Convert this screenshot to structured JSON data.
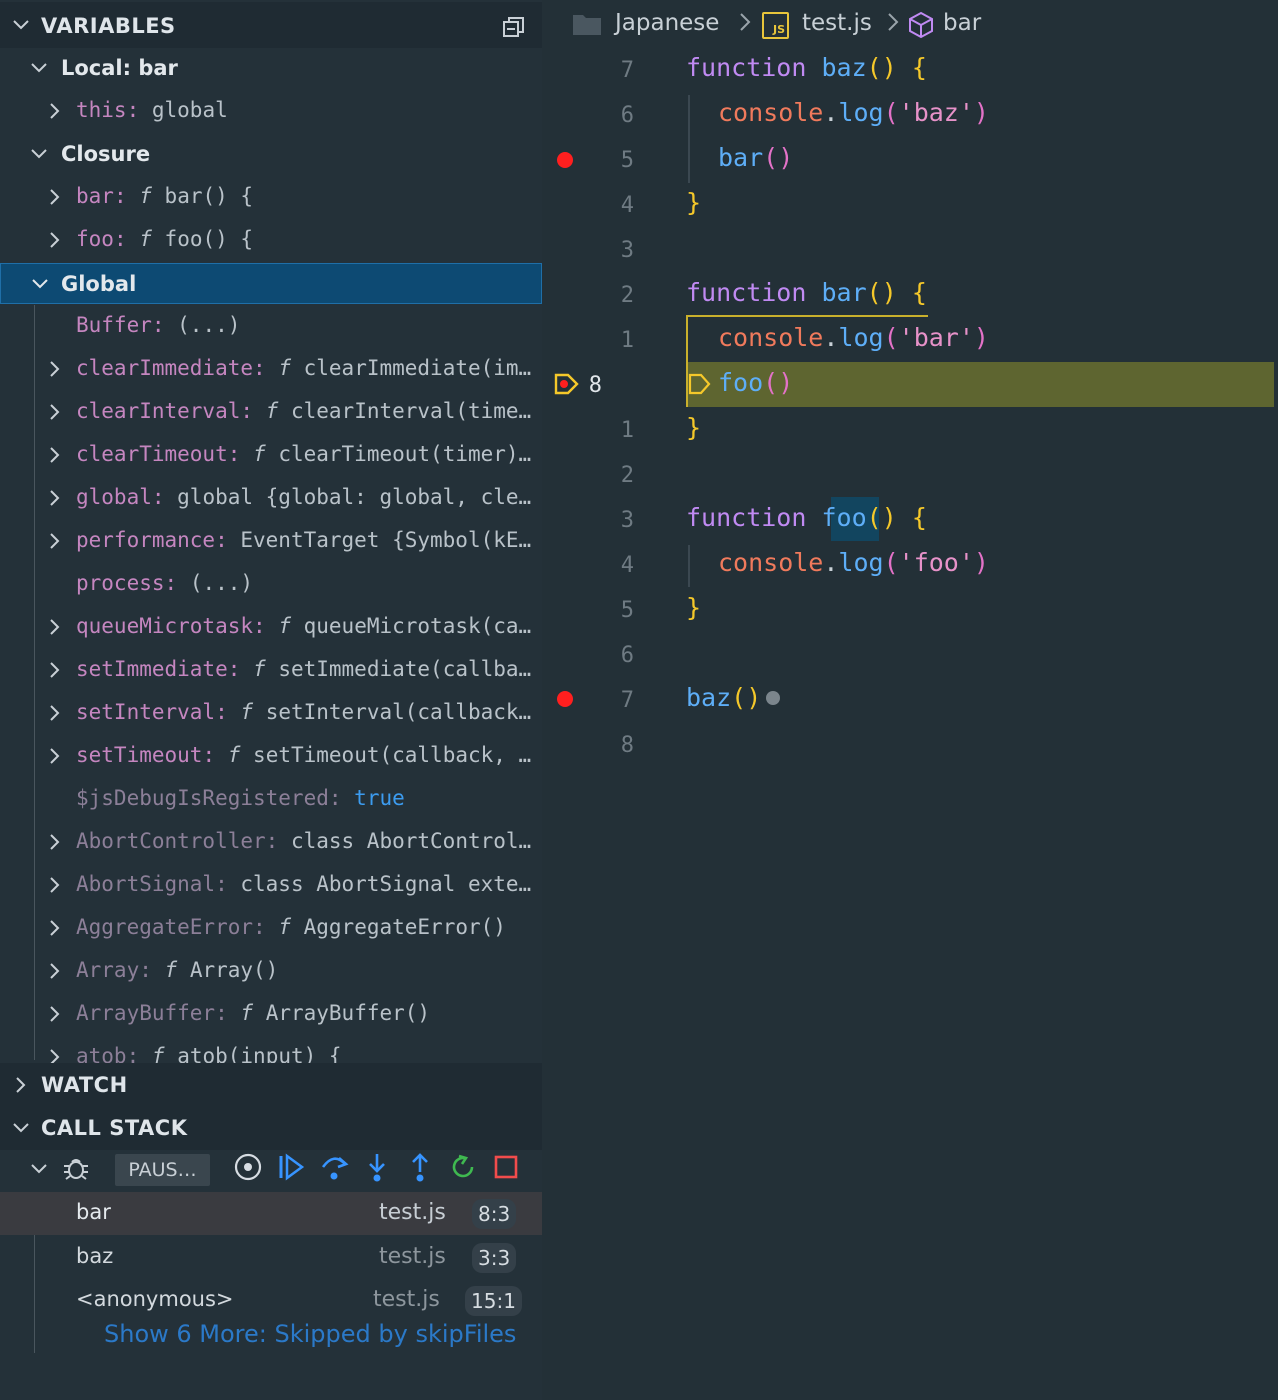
{
  "variables": {
    "title": "VARIABLES",
    "scopes": {
      "local": "Local: bar",
      "closure": "Closure",
      "global": "Global"
    },
    "local_rows": [
      {
        "name": "this",
        "value": "global"
      }
    ],
    "closure_rows": [
      {
        "name": "bar",
        "value": "bar() {",
        "fn": "f"
      },
      {
        "name": "foo",
        "value": "foo() {",
        "fn": "f"
      }
    ],
    "global_rows": [
      {
        "name": "Buffer",
        "value": "(...)"
      },
      {
        "name": "clearImmediate",
        "fn": "f",
        "value": "clearImmediate(im…"
      },
      {
        "name": "clearInterval",
        "fn": "f",
        "value": "clearInterval(time…"
      },
      {
        "name": "clearTimeout",
        "fn": "f",
        "value": "clearTimeout(timer)…"
      },
      {
        "name": "global",
        "value": "global {global: global, cle…"
      },
      {
        "name": "performance",
        "value": "EventTarget {Symbol(kE…"
      },
      {
        "name": "process",
        "value": "(...)"
      },
      {
        "name": "queueMicrotask",
        "fn": "f",
        "value": "queueMicrotask(ca…"
      },
      {
        "name": "setImmediate",
        "fn": "f",
        "value": "setImmediate(callba…"
      },
      {
        "name": "setInterval",
        "fn": "f",
        "value": "setInterval(callback…"
      },
      {
        "name": "setTimeout",
        "fn": "f",
        "value": "setTimeout(callback, …"
      },
      {
        "name": "$jsDebugIsRegistered",
        "value": "true"
      },
      {
        "name": "AbortController",
        "value": "class AbortControl…"
      },
      {
        "name": "AbortSignal",
        "value": "class AbortSignal exte…"
      },
      {
        "name": "AggregateError",
        "fn": "f",
        "value": "AggregateError()"
      },
      {
        "name": "Array",
        "fn": "f",
        "value": "Array()"
      },
      {
        "name": "ArrayBuffer",
        "fn": "f",
        "value": "ArrayBuffer()"
      },
      {
        "name": "atob",
        "fn": "f",
        "value": "atob(input) {"
      }
    ]
  },
  "watch": {
    "title": "WATCH"
  },
  "call_stack": {
    "title": "CALL STACK",
    "status": "PAUS…",
    "frames": [
      {
        "name": "bar",
        "file": "test.js",
        "pos": "8:3"
      },
      {
        "name": "baz",
        "file": "test.js",
        "pos": "3:3"
      },
      {
        "name": "<anonymous>",
        "file": "test.js",
        "pos": "15:1"
      }
    ],
    "more_link": "Show 6 More: Skipped by skipFiles"
  },
  "breadcrumb": {
    "folder": "Japanese",
    "file": "test.js",
    "file_icon_text": "JS",
    "symbol": "bar"
  },
  "editor": {
    "line_numbers": [
      "7",
      "6",
      "5",
      "4",
      "3",
      "2",
      "1",
      "8",
      "1",
      "2",
      "3",
      "4",
      "5",
      "6",
      "7",
      "8"
    ],
    "current_line_index": 7,
    "tokens": {
      "function": "function",
      "baz": "baz",
      "bar": "bar",
      "foo": "foo",
      "console": "console",
      "log": "log",
      "s_baz": "'baz'",
      "s_bar": "'bar'",
      "s_foo": "'foo'"
    }
  },
  "colors": {
    "accent": "#0d4a73",
    "breakpoint": "#ff1f1f",
    "current_line": "#5e6530"
  }
}
